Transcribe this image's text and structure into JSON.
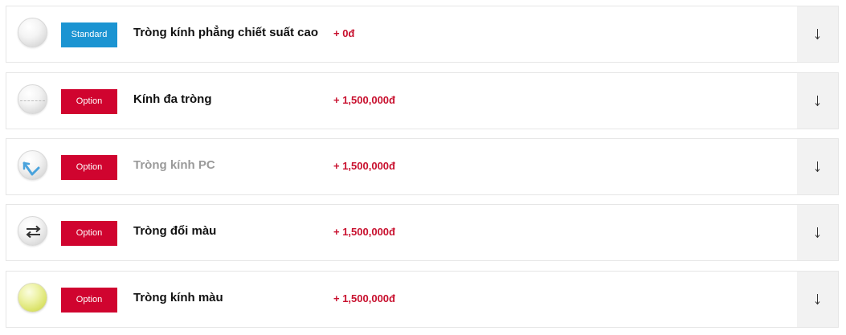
{
  "options": [
    {
      "badge": "Standard",
      "badge_type": "standard",
      "name": "Tròng kính phẳng chiết suất cao",
      "price": "+ 0đ",
      "lens_icon": "clear-lens-icon",
      "muted": false
    },
    {
      "badge": "Option",
      "badge_type": "option",
      "name": "Kính đa tròng",
      "price": "+ 1,500,000đ",
      "lens_icon": "progressive-lens-icon",
      "muted": false
    },
    {
      "badge": "Option",
      "badge_type": "option",
      "name": "Tròng kính PC",
      "price": "+ 1,500,000đ",
      "lens_icon": "pc-lens-icon",
      "muted": true
    },
    {
      "badge": "Option",
      "badge_type": "option",
      "name": "Tròng đổi màu",
      "price": "+ 1,500,000đ",
      "lens_icon": "photochromic-lens-icon",
      "muted": false
    },
    {
      "badge": "Option",
      "badge_type": "option",
      "name": "Tròng kính màu",
      "price": "+ 1,500,000đ",
      "lens_icon": "tinted-lens-icon",
      "muted": false
    }
  ],
  "colors": {
    "standard_badge": "#1b94d2",
    "option_badge": "#d0042f",
    "price": "#c8102e",
    "muted_name": "#9a9a9a",
    "arrow_panel": "#f2f2f2"
  },
  "expand_icon": "arrow-down-icon"
}
